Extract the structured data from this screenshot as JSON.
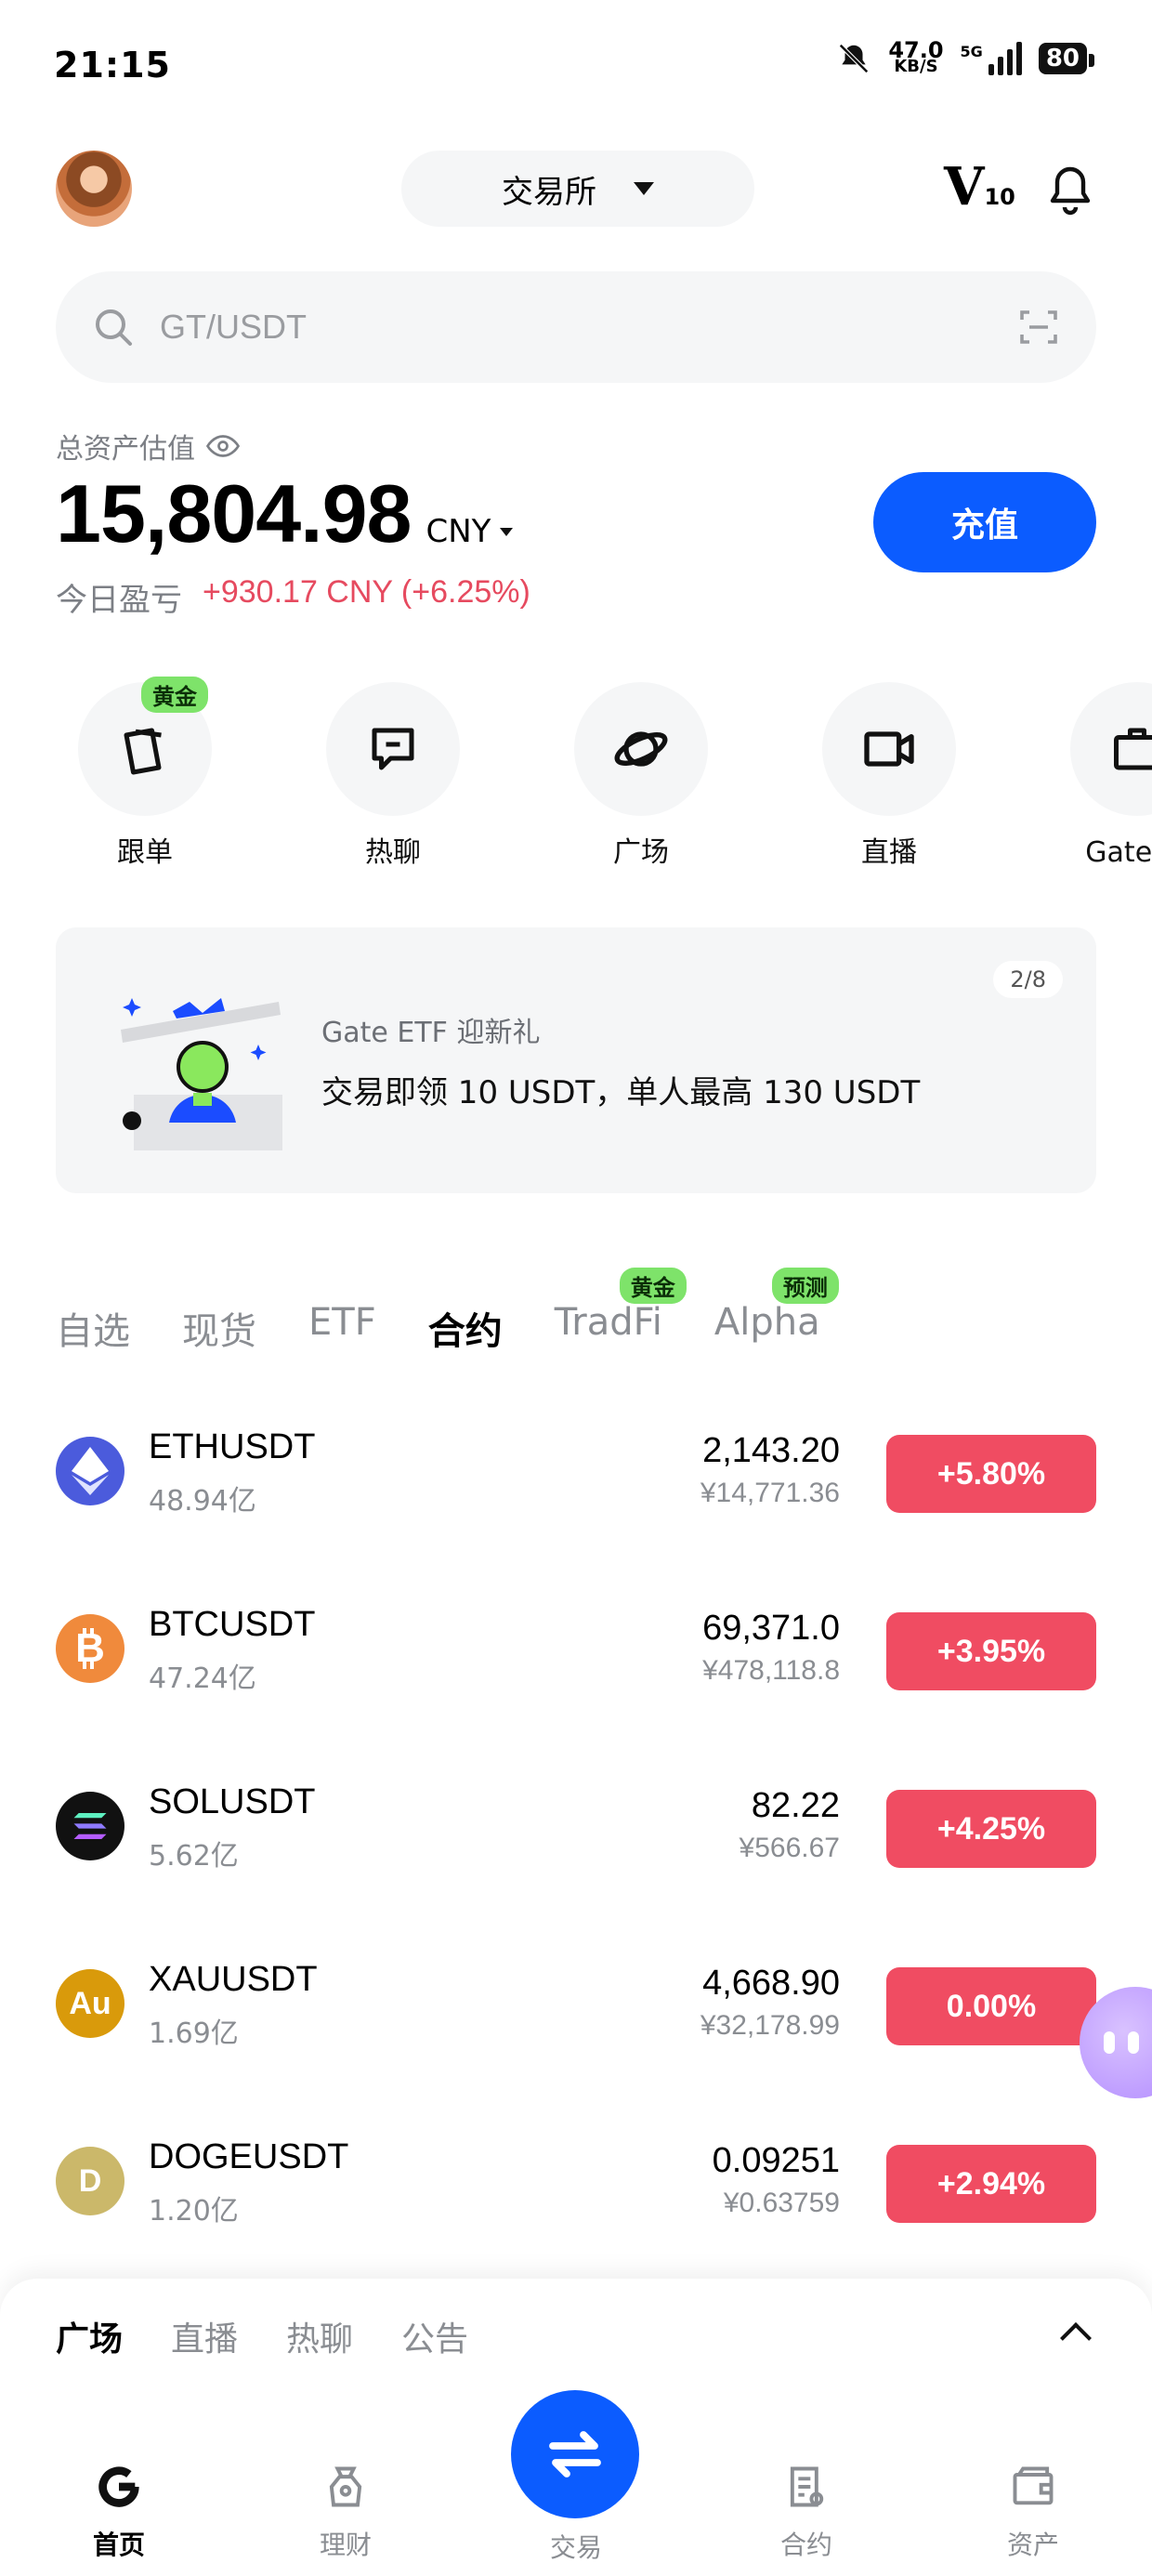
{
  "status_bar": {
    "time": "21:15",
    "net_speed": "47.0",
    "net_unit": "KB/S",
    "network": "5G",
    "battery": "80"
  },
  "header": {
    "exchange_selector": "交易所",
    "vip_level_prefix": "V",
    "vip_level_num": "10"
  },
  "search": {
    "placeholder": "GT/USDT"
  },
  "assets": {
    "label": "总资产估值",
    "total": "15,804.98",
    "currency": "CNY",
    "pnl_label": "今日盈亏",
    "pnl_value": "+930.17 CNY (+6.25%)",
    "deposit_label": "充值"
  },
  "shortcuts": [
    {
      "label": "跟单",
      "icon": "copy-trade-icon",
      "badge": "黄金"
    },
    {
      "label": "热聊",
      "icon": "chat-icon"
    },
    {
      "label": "广场",
      "icon": "planet-icon"
    },
    {
      "label": "直播",
      "icon": "live-camera-icon"
    },
    {
      "label": "Gate 商",
      "icon": "bag-icon"
    }
  ],
  "banner": {
    "page": "2/8",
    "title": "Gate ETF 迎新礼",
    "text": "交易即领 10 USDT，单人最高 130 USDT"
  },
  "market_tabs": [
    {
      "label": "自选"
    },
    {
      "label": "现货"
    },
    {
      "label": "ETF"
    },
    {
      "label": "合约",
      "active": true
    },
    {
      "label": "TradFi",
      "tag": "黄金"
    },
    {
      "label": "Alpha",
      "tag": "预测"
    }
  ],
  "markets": [
    {
      "symbol": "ETHUSDT",
      "volume": "48.94亿",
      "price": "2,143.20",
      "price_cny": "¥14,771.36",
      "change": "+5.80%",
      "icon": "eth-icon",
      "color": "#4b5bdc"
    },
    {
      "symbol": "BTCUSDT",
      "volume": "47.24亿",
      "price": "69,371.0",
      "price_cny": "¥478,118.8",
      "change": "+3.95%",
      "icon": "btc-icon",
      "color": "#f08a3c"
    },
    {
      "symbol": "SOLUSDT",
      "volume": "5.62亿",
      "price": "82.22",
      "price_cny": "¥566.67",
      "change": "+4.25%",
      "icon": "sol-icon",
      "color": "#111111"
    },
    {
      "symbol": "XAUUSDT",
      "volume": "1.69亿",
      "price": "4,668.90",
      "price_cny": "¥32,178.99",
      "change": "0.00%",
      "icon": "gold-au-icon",
      "color": "#d99a0b",
      "icon_text": "Au"
    },
    {
      "symbol": "DOGEUSDT",
      "volume": "1.20亿",
      "price": "0.09251",
      "price_cny": "¥0.63759",
      "change": "+2.94%",
      "icon": "doge-icon",
      "color": "#cbb86a",
      "icon_text": "D"
    }
  ],
  "feed_tabs": [
    "广场",
    "直播",
    "热聊",
    "公告"
  ],
  "bottom_nav": [
    {
      "label": "首页",
      "icon": "home-icon",
      "active": true
    },
    {
      "label": "理财",
      "icon": "finance-icon"
    },
    {
      "label": "交易",
      "icon": "trade-swap-icon"
    },
    {
      "label": "合约",
      "icon": "contract-icon"
    },
    {
      "label": "资产",
      "icon": "wallet-icon"
    }
  ],
  "colors": {
    "accent": "#0b5cff",
    "up": "#f04c62",
    "badge_green": "#7ee36a"
  }
}
